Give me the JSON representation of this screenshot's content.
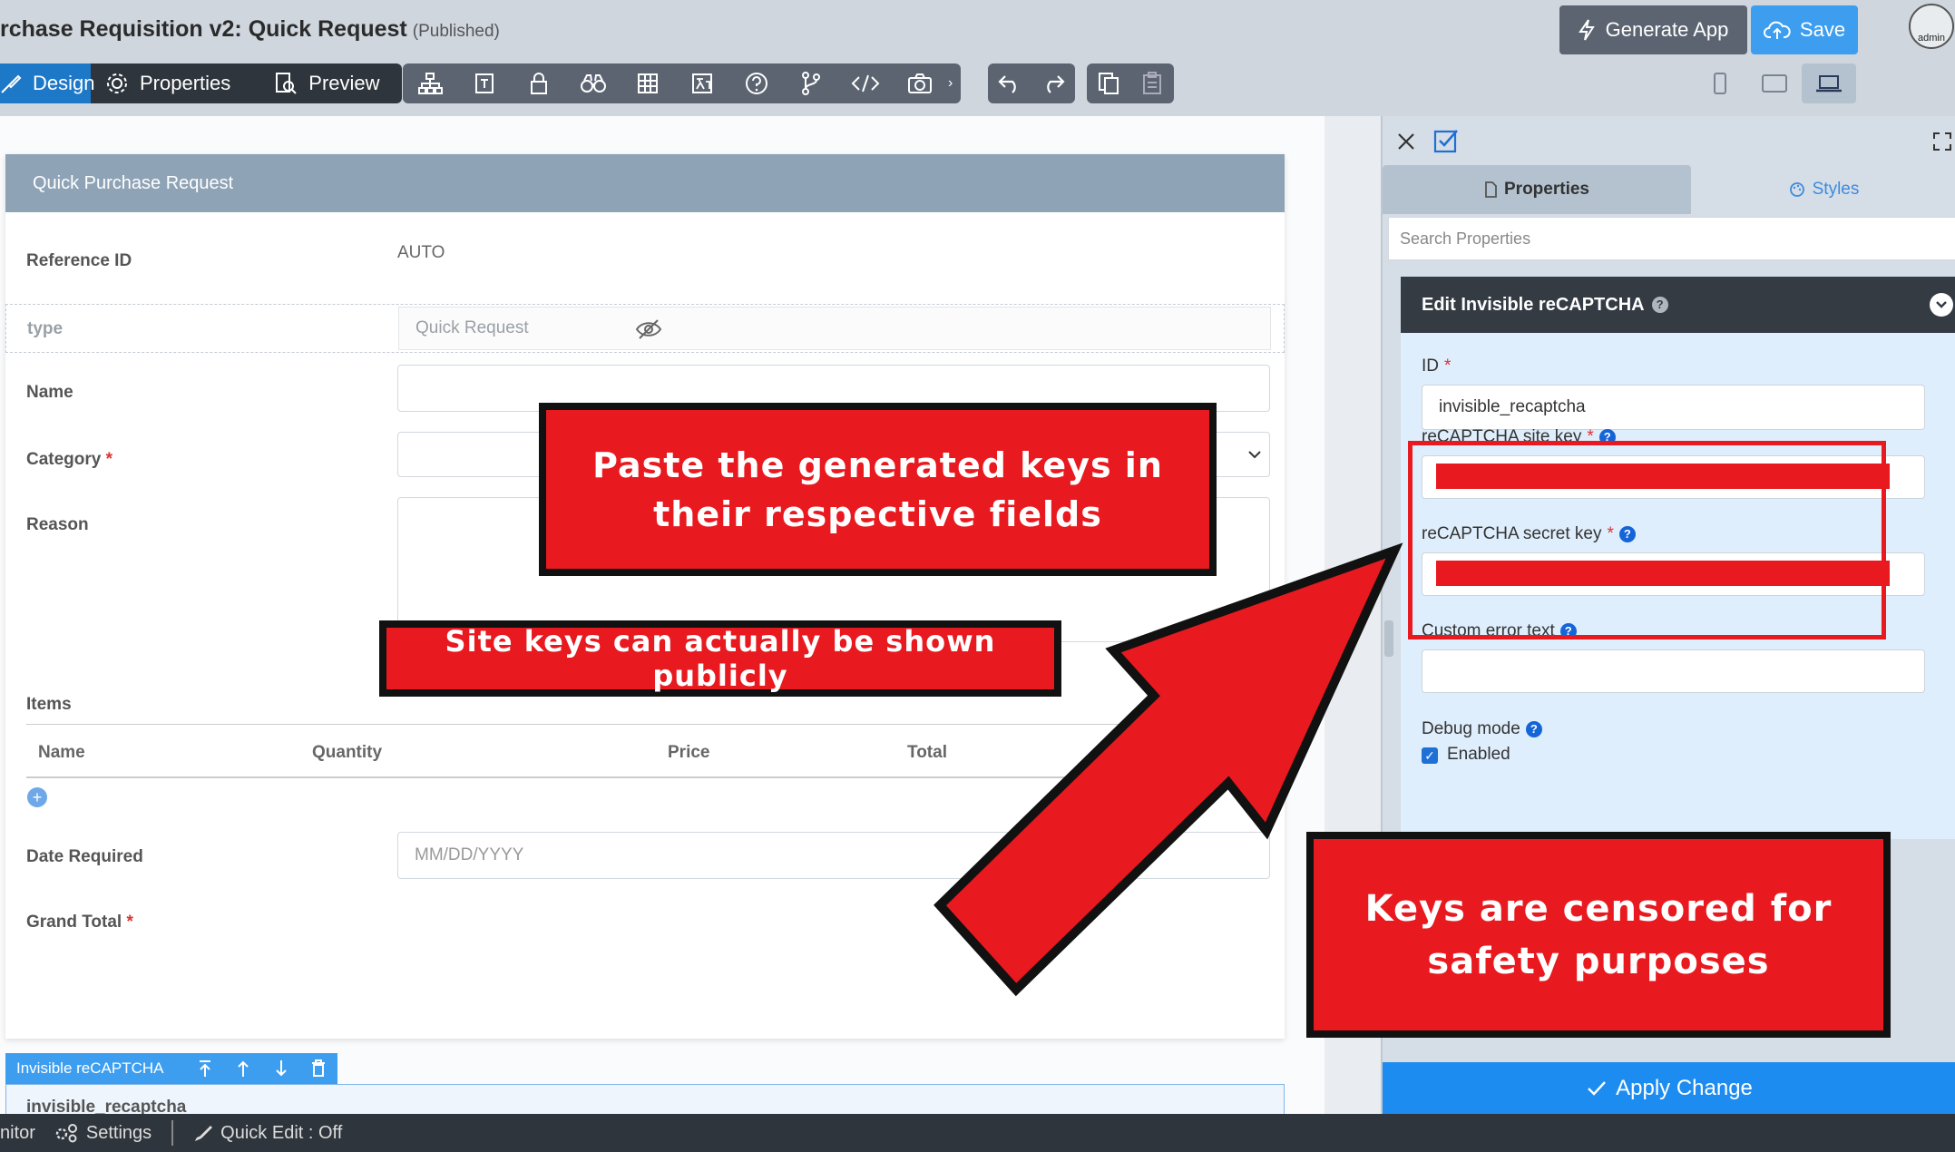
{
  "app": {
    "title": "rchase Requisition v2: Quick Request",
    "status": "(Published)",
    "generate_label": "Generate App",
    "save_label": "Save",
    "avatar_label": "admin"
  },
  "modes": {
    "design": "Design",
    "properties": "Properties",
    "preview": "Preview"
  },
  "form": {
    "header": "Quick Purchase Request",
    "reference_label": "Reference ID",
    "reference_value": "AUTO",
    "type_label": "type",
    "type_value": "Quick Request",
    "name_label": "Name",
    "category_label": "Category",
    "reason_label": "Reason",
    "items_label": "Items",
    "item_columns": [
      "Name",
      "Quantity",
      "Price",
      "Total"
    ],
    "date_label": "Date Required",
    "date_placeholder": "MM/DD/YYYY",
    "grand_total_label": "Grand Total",
    "required_mark": "*",
    "widget_label": "Invisible reCAPTCHA",
    "widget_id": "invisible_recaptcha"
  },
  "panel": {
    "tab_properties": "Properties",
    "tab_styles": "Styles",
    "search_placeholder": "Search Properties",
    "edit_title": "Edit Invisible reCAPTCHA",
    "id_label": "ID",
    "id_value": "invisible_recaptcha",
    "site_key_label": "reCAPTCHA site key",
    "secret_key_label": "reCAPTCHA secret key",
    "custom_error_label": "Custom error text",
    "debug_label": "Debug mode",
    "debug_option": "Enabled",
    "apply_label": "Apply Change"
  },
  "footer": {
    "monitor": "nitor",
    "settings": "Settings",
    "quick_edit": "Quick Edit : Off"
  },
  "annotations": {
    "paste_keys": "Paste the generated keys in their respective fields",
    "site_keys_public": "Site keys can actually be shown publicly",
    "keys_censored": "Keys are censored for safety purposes"
  },
  "colors": {
    "accent": "#1d8cf0",
    "annotation_red": "#e8191f",
    "dark": "#2e353c"
  }
}
